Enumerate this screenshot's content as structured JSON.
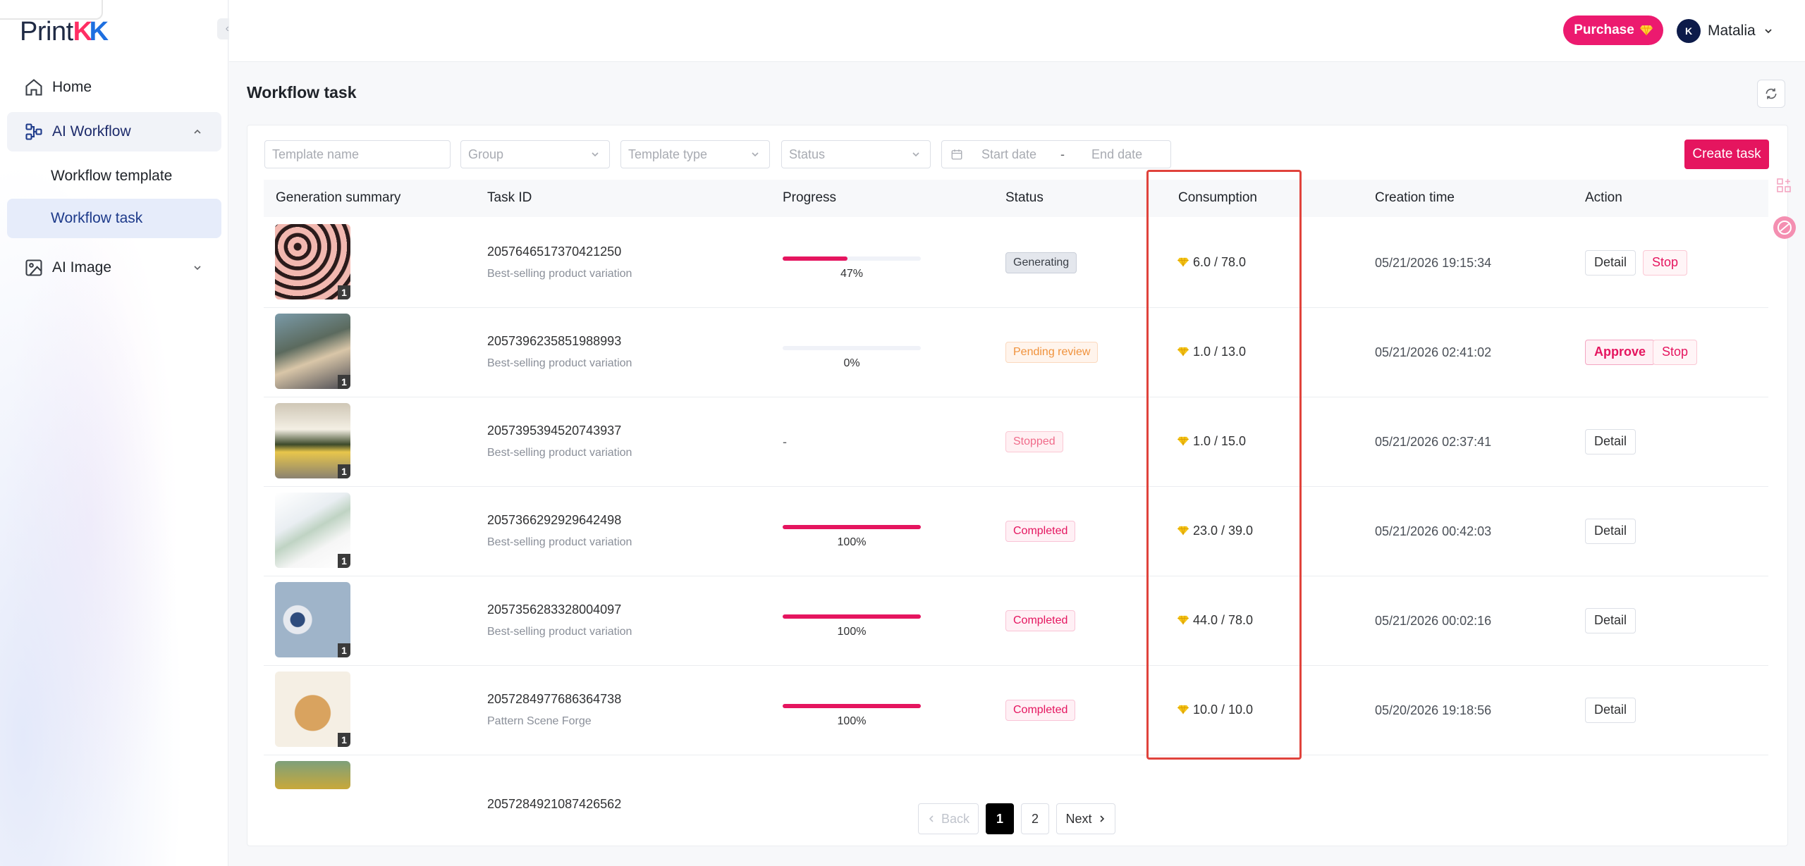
{
  "brand": {
    "logo_prefix": "Print",
    "logo_k1": "K",
    "logo_k2": "K"
  },
  "sidebar": {
    "items": [
      {
        "label": "Home",
        "icon": "home-icon"
      },
      {
        "label": "AI Workflow",
        "icon": "workflow-icon",
        "expanded": true
      },
      {
        "label": "Workflow template"
      },
      {
        "label": "Workflow task",
        "active": true
      },
      {
        "label": "AI Image",
        "icon": "image-icon",
        "expanded": false
      }
    ]
  },
  "header": {
    "purchase_label": "Purchase",
    "user_name": "Matalia",
    "avatar_text": "K"
  },
  "page": {
    "title": "Workflow task"
  },
  "filters": {
    "template_name_placeholder": "Template name",
    "group_placeholder": "Group",
    "template_type_placeholder": "Template type",
    "status_placeholder": "Status",
    "start_date_placeholder": "Start date",
    "date_separator": "-",
    "end_date_placeholder": "End date",
    "create_label": "Create task"
  },
  "table": {
    "columns": [
      "Generation summary",
      "Task ID",
      "Progress",
      "Status",
      "Consumption",
      "Creation time",
      "Action"
    ],
    "rows": [
      {
        "task_id": "2057646517370421250",
        "template": "Best-selling product variation",
        "progress": 47,
        "progress_label": "47%",
        "status": "Generating",
        "consumption": "6.0 / 78.0",
        "created": "05/21/2026 19:15:34",
        "actions": [
          "Detail",
          "Stop"
        ],
        "count": "1"
      },
      {
        "task_id": "2057396235851988993",
        "template": "Best-selling product variation",
        "progress": 0,
        "progress_label": "0%",
        "status": "Pending review",
        "consumption": "1.0 / 13.0",
        "created": "05/21/2026 02:41:02",
        "actions": [
          "Approve",
          "Stop"
        ],
        "count": "1"
      },
      {
        "task_id": "2057395394520743937",
        "template": "Best-selling product variation",
        "progress": null,
        "progress_label": "-",
        "status": "Stopped",
        "consumption": "1.0 / 15.0",
        "created": "05/21/2026 02:37:41",
        "actions": [
          "Detail"
        ],
        "count": "1"
      },
      {
        "task_id": "2057366292929642498",
        "template": "Best-selling product variation",
        "progress": 100,
        "progress_label": "100%",
        "status": "Completed",
        "consumption": "23.0 / 39.0",
        "created": "05/21/2026 00:42:03",
        "actions": [
          "Detail"
        ],
        "count": "1"
      },
      {
        "task_id": "2057356283328004097",
        "template": "Best-selling product variation",
        "progress": 100,
        "progress_label": "100%",
        "status": "Completed",
        "consumption": "44.0 / 78.0",
        "created": "05/21/2026 00:02:16",
        "actions": [
          "Detail"
        ],
        "count": "1"
      },
      {
        "task_id": "2057284977686364738",
        "template": "Pattern Scene Forge",
        "progress": 100,
        "progress_label": "100%",
        "status": "Completed",
        "consumption": "10.0 / 10.0",
        "created": "05/20/2026 19:18:56",
        "actions": [
          "Detail"
        ],
        "count": "1"
      },
      {
        "task_id": "2057284921087426562"
      }
    ]
  },
  "pagination": {
    "back": "Back",
    "pages": [
      "1",
      "2"
    ],
    "current": "1",
    "next": "Next"
  },
  "colors": {
    "accent": "#e5155f",
    "highlight": "#e0433c",
    "gem": "#f5c518"
  }
}
